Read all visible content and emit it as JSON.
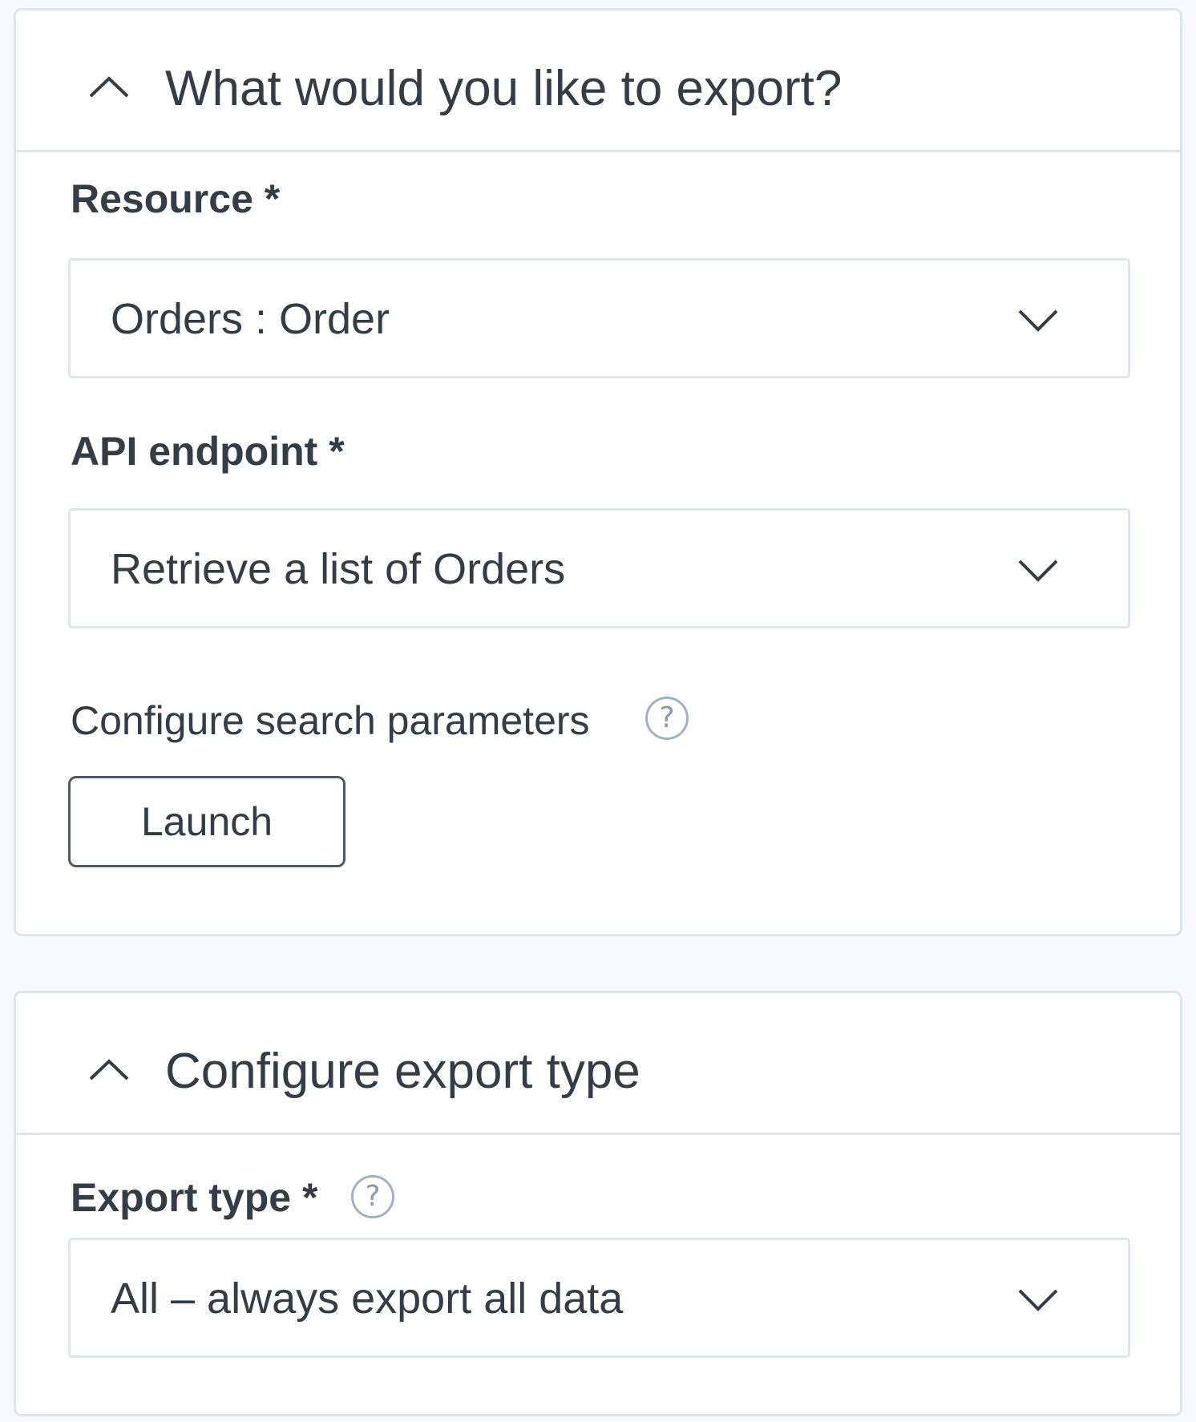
{
  "export_section": {
    "title": "What would you like to export?",
    "resource": {
      "label": "Resource *",
      "value": "Orders : Order"
    },
    "api_endpoint": {
      "label": "API endpoint *",
      "value": "Retrieve a list of Orders"
    },
    "search_params": {
      "label": "Configure search parameters",
      "help_glyph": "?",
      "button_label": "Launch"
    }
  },
  "export_type_section": {
    "title": "Configure export type",
    "export_type": {
      "label": "Export type *",
      "help_glyph": "?",
      "value": "All – always export all data"
    }
  },
  "colors": {
    "text": "#333d47",
    "border": "#dfe5ec",
    "help_icon": "#a3b1c2",
    "page_background": "#f7f9fc"
  }
}
